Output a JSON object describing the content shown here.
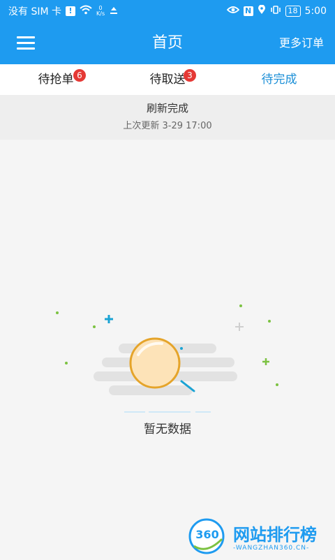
{
  "status": {
    "carrier": "没有 SIM 卡",
    "speed_top": "0",
    "speed_bottom": "K/s",
    "battery": "18",
    "time": "5:00"
  },
  "header": {
    "title": "首页",
    "more_orders": "更多订单"
  },
  "tabs": [
    {
      "label": "待抢单",
      "count": "6"
    },
    {
      "label": "待取送",
      "count": "3"
    },
    {
      "label": "待完成"
    }
  ],
  "refresh": {
    "title": "刷新完成",
    "last_update": "上次更新 3-29 17:00"
  },
  "empty": {
    "text": "暂无数据"
  },
  "watermark": {
    "brand": "网站排行榜",
    "sub": "-WANGZHAN360.CN-",
    "logo": "360"
  }
}
